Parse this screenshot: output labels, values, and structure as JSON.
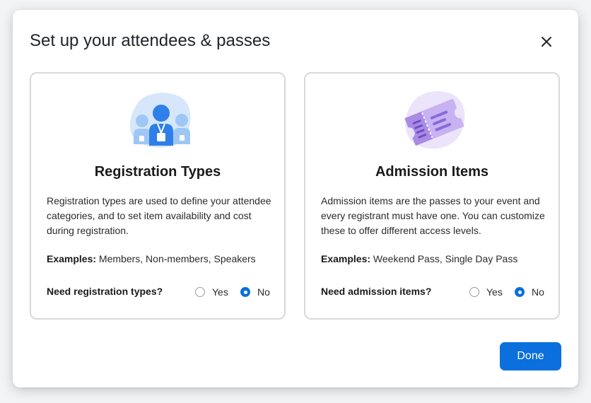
{
  "dialog": {
    "title": "Set up your attendees & passes",
    "done_label": "Done",
    "close_icon": "close-icon"
  },
  "cards": [
    {
      "title": "Registration Types",
      "description": "Registration types are used to define your attendee categories, and to set item availability and cost during registration.",
      "examples_label": "Examples:",
      "examples_value": " Members, Non-members, Speakers",
      "question": "Need registration types?",
      "options": [
        "Yes",
        "No"
      ],
      "selected": "No",
      "illustration_icon": "attendees-group-icon"
    },
    {
      "title": "Admission Items",
      "description": "Admission items are the passes to your event and every registrant must have one. You can customize these to offer different access levels.",
      "examples_label": "Examples:",
      "examples_value": " Weekend Pass, Single Day Pass",
      "question": "Need admission items?",
      "options": [
        "Yes",
        "No"
      ],
      "selected": "No",
      "illustration_icon": "ticket-icon"
    }
  ],
  "colors": {
    "accent": "#0b6fde",
    "card_border": "#d9d9d9",
    "attendee_blue": "#2f7fe8",
    "ticket_purple": "#a98be6"
  }
}
